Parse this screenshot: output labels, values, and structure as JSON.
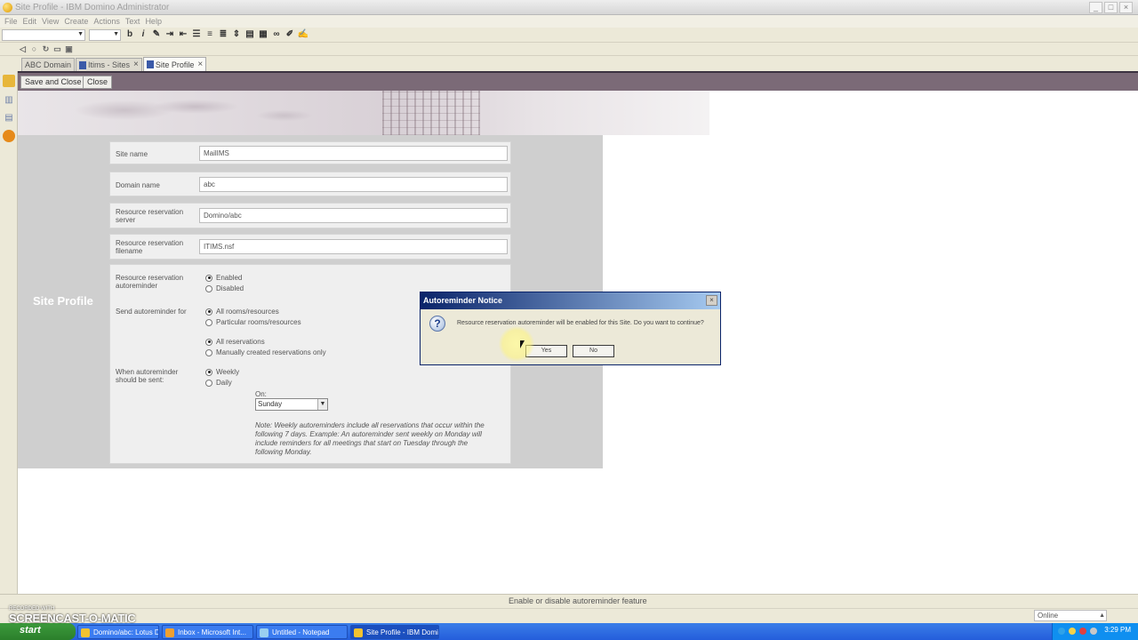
{
  "window": {
    "title": "Site Profile - IBM Domino Administrator",
    "controls": [
      "_",
      "□",
      "×"
    ]
  },
  "menu": [
    "File",
    "Edit",
    "View",
    "Create",
    "Actions",
    "Text",
    "Help"
  ],
  "toolbar_icons": [
    "bold-icon",
    "italic-icon",
    "pen-icon",
    "indent-icon",
    "outdent-icon",
    "bullets-icon",
    "numbering-icon",
    "align-icon",
    "spacing-icon",
    "border-icon",
    "table-icon",
    "link-icon",
    "permanent-pen-icon",
    "highlight-icon"
  ],
  "tabs": [
    {
      "label": "ABC Domain",
      "closable": false
    },
    {
      "label": "Itims - Sites",
      "closable": true
    },
    {
      "label": "Site Profile",
      "closable": true,
      "active": true
    }
  ],
  "actions": {
    "save_close": "Save and Close",
    "close": "Close"
  },
  "form": {
    "side_title": "Site Profile",
    "site_name": {
      "label": "Site name",
      "value": "MailIMS"
    },
    "domain_name": {
      "label": "Domain name",
      "value": "abc"
    },
    "rr_server": {
      "label_line1": "Resource reservation",
      "label_line2": "server",
      "value": "Domino/abc"
    },
    "rr_filename": {
      "label_line1": "Resource reservation",
      "label_line2": "filename",
      "value": "ITIMS.nsf"
    },
    "autoreminder": {
      "label_line1": "Resource reservation",
      "label_line2": "autoreminder",
      "options": [
        "Enabled",
        "Disabled"
      ],
      "selected": "Enabled"
    },
    "send_for": {
      "label": "Send autoreminder for",
      "options": [
        "All rooms/resources",
        "Particular rooms/resources"
      ],
      "selected": "All rooms/resources"
    },
    "reservations": {
      "options": [
        "All reservations",
        "Manually created reservations only"
      ],
      "selected": "All reservations"
    },
    "when_sent": {
      "label_line1": "When autoreminder",
      "label_line2": "should be sent:",
      "options": [
        "Weekly",
        "Daily"
      ],
      "selected": "Weekly"
    },
    "on": {
      "label": "On:",
      "value": "Sunday"
    },
    "note": "Note: Weekly autoreminders include all reservations that occur within the following 7 days. Example: An autoreminder sent weekly on Monday will include reminders for all meetings that start on Tuesday through the following Monday."
  },
  "dialog": {
    "title": "Autoreminder Notice",
    "message": "Resource reservation autoreminder will be enabled for this Site.  Do you want to continue?",
    "yes": "Yes",
    "no": "No"
  },
  "status": {
    "message": "Enable or disable autoreminder feature",
    "location": "Online"
  },
  "taskbar": {
    "start": "start",
    "tasks": [
      {
        "label": "Domino/abc: Lotus D...",
        "color": "#f2c230"
      },
      {
        "label": "Inbox - Microsoft Int...",
        "color": "#f0a030"
      },
      {
        "label": "Untitled - Notepad",
        "color": "#9ad0f0"
      },
      {
        "label": "Site Profile - IBM Domi...",
        "color": "#f2c230",
        "active": true
      }
    ],
    "clock": "3:29 PM"
  },
  "watermark": {
    "recorded_with": "RECORDED WITH",
    "brand": "SCREENCAST-O-MATIC"
  }
}
